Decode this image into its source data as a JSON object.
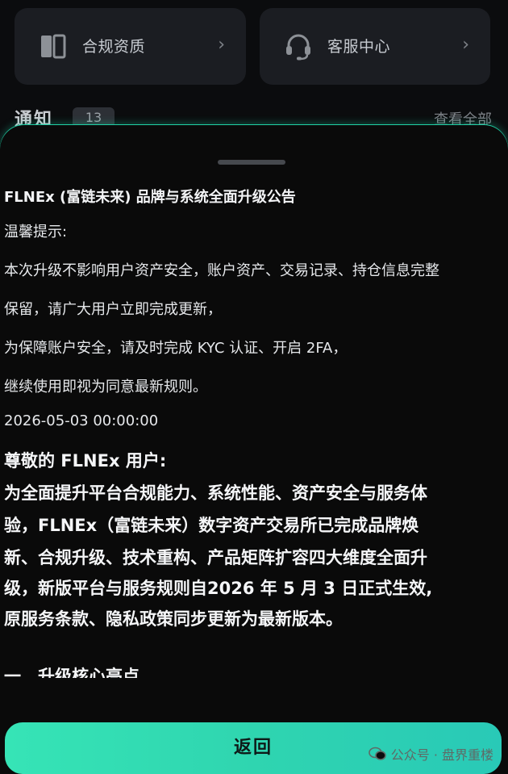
{
  "cards": {
    "compliance": {
      "label": "合规资质",
      "icon": "book-icon"
    },
    "support": {
      "label": "客服中心",
      "icon": "headset-icon"
    },
    "chevron": "›"
  },
  "notice": {
    "title": "通知",
    "count": "13",
    "view_all": "查看全部"
  },
  "sheet": {
    "title": "FLNEx (富链未来) 品牌与系统全面升级公告",
    "tip_label": "温馨提示:",
    "tip_lines": [
      "本次升级不影响用户资产安全，账户资产、交易记录、持仓信息完整",
      "保留，请广大用户立即完成更新，",
      "为保障账户安全，请及时完成 KYC 认证、开启 2FA，",
      "继续使用即视为同意最新规则。"
    ],
    "timestamp": "2026-05-03 00:00:00",
    "greeting": "尊敬的 FLNEx 用户:",
    "body_lines": [
      "为全面提升平台合规能力、系统性能、资产安全与服务体",
      "验，FLNEx（富链未来）数字资产交易所已完成品牌焕",
      "新、合规升级、技术重构、产品矩阵扩容四大维度全面升",
      "级，新版平台与服务规则自2026 年 5 月 3 日正式生效,",
      "原服务条款、隐私政策同步更新为最新版本。"
    ],
    "section_heading": "一、升级核心亮点"
  },
  "footer": {
    "back_label": "返回",
    "watermark": "公众号 · 盘界重楼"
  },
  "colors": {
    "accent": "#2fd5b0",
    "background": "#0b0c0e",
    "card": "#1b1d22"
  }
}
